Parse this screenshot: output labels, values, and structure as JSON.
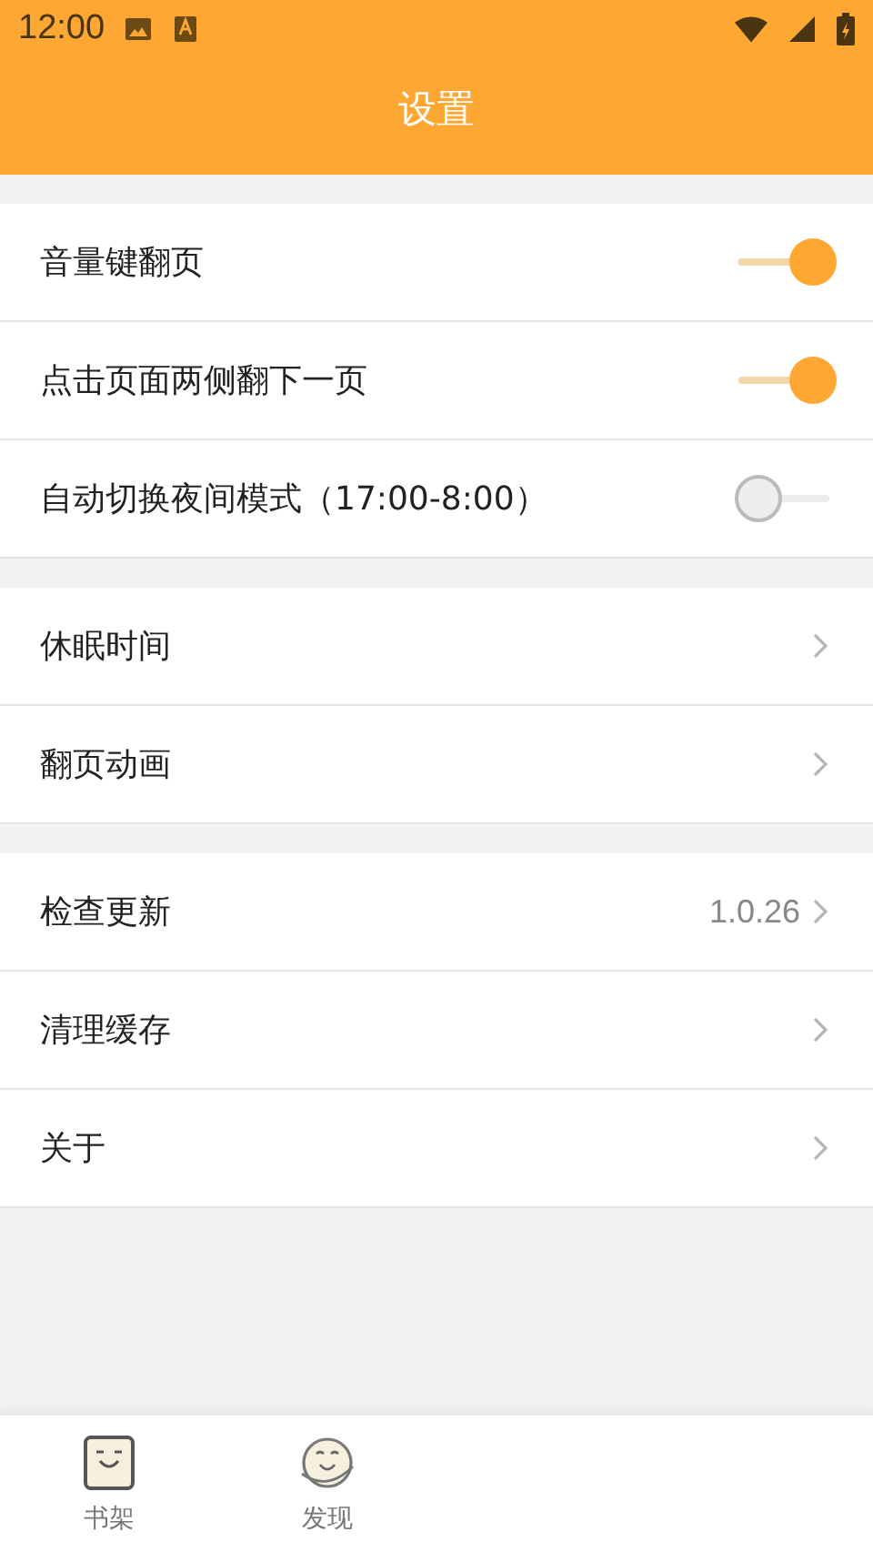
{
  "status_bar": {
    "time": "12:00"
  },
  "header": {
    "title": "设置"
  },
  "groups": [
    {
      "rows": [
        {
          "kind": "toggle",
          "label": "音量键翻页",
          "on": true
        },
        {
          "kind": "toggle",
          "label": "点击页面两侧翻下一页",
          "on": true
        },
        {
          "kind": "toggle",
          "label": "自动切换夜间模式（17:00-8:00）",
          "on": false
        }
      ]
    },
    {
      "rows": [
        {
          "kind": "link",
          "label": "休眠时间"
        },
        {
          "kind": "link",
          "label": "翻页动画"
        }
      ]
    },
    {
      "rows": [
        {
          "kind": "link",
          "label": "检查更新",
          "value": "1.0.26"
        },
        {
          "kind": "link",
          "label": "清理缓存"
        },
        {
          "kind": "link",
          "label": "关于"
        }
      ]
    }
  ],
  "bottom_nav": [
    {
      "kind": "shelf",
      "label": "书架"
    },
    {
      "kind": "discover",
      "label": "发现"
    }
  ]
}
